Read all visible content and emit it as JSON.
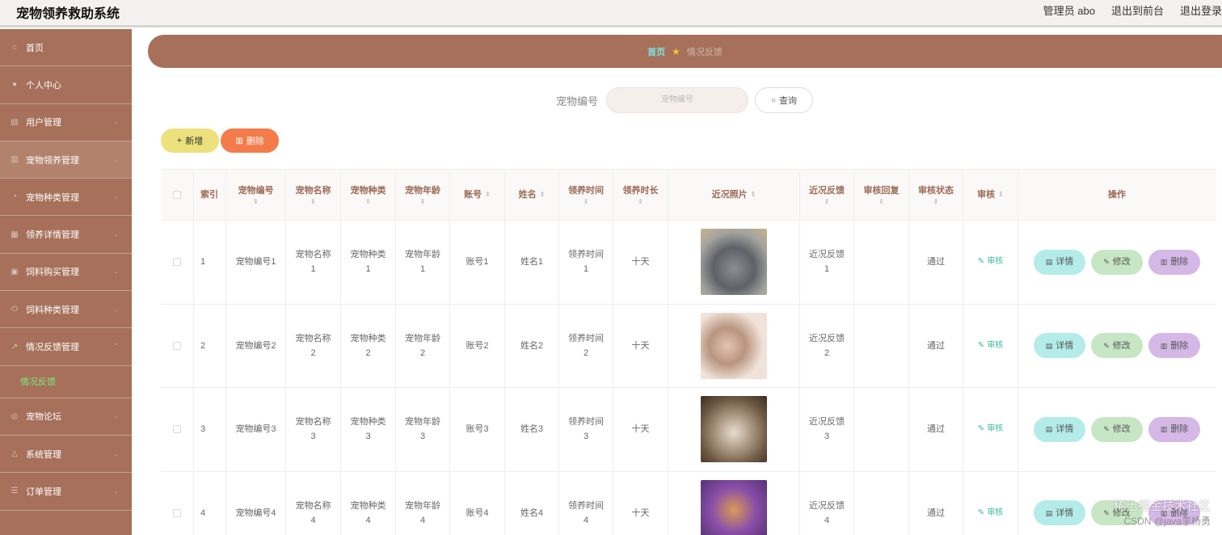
{
  "header": {
    "title": "宠物领养救助系统",
    "admin_label": "管理员 abo",
    "back_to_front": "退出到前台",
    "logout": "退出登录"
  },
  "sidebar": {
    "items": [
      {
        "label": "首页",
        "icon": "home-icon"
      },
      {
        "label": "个人中心",
        "icon": "user-icon"
      },
      {
        "label": "用户管理",
        "icon": "document-icon"
      },
      {
        "label": "宠物领养管理",
        "icon": "chart-icon"
      },
      {
        "label": "宠物种类管理",
        "icon": "dashboard-icon"
      },
      {
        "label": "领养详情管理",
        "icon": "grid-icon"
      },
      {
        "label": "饲料购买管理",
        "icon": "briefcase-icon"
      },
      {
        "label": "饲料种类管理",
        "icon": "power-icon"
      },
      {
        "label": "情况反馈管理",
        "icon": "trend-icon"
      },
      {
        "label": "宠物论坛",
        "icon": "compass-icon"
      },
      {
        "label": "系统管理",
        "icon": "bell-icon"
      },
      {
        "label": "订单管理",
        "icon": "sliders-icon"
      }
    ],
    "submenu_label": "情况反馈"
  },
  "breadcrumb": {
    "home": "首页",
    "current": "情况反馈"
  },
  "search": {
    "label": "宠物编号",
    "placeholder": "宠物编号",
    "button": "查询"
  },
  "toolbar": {
    "add_label": "新增",
    "delete_label": "删除"
  },
  "table": {
    "headers": {
      "index": "索引",
      "pet_no": "宠物编号",
      "pet_name": "宠物名称",
      "pet_type": "宠物种类",
      "pet_age": "宠物年龄",
      "account": "账号",
      "name": "姓名",
      "adopt_time": "领养时间",
      "adopt_duration": "领养时长",
      "photo": "近况照片",
      "feedback": "近况反馈",
      "reply": "审核回复",
      "status": "审核状态",
      "audit": "审核",
      "actions": "操作"
    },
    "rows": [
      {
        "index": "1",
        "pet_no": "宠物编号1",
        "pet_name": "宠物名称1",
        "pet_type": "宠物种类1",
        "pet_age": "宠物年龄1",
        "account": "账号1",
        "name": "姓名1",
        "adopt_time": "领养时间1",
        "duration": "十天",
        "feedback": "近况反馈1",
        "reply": "",
        "status": "通过",
        "audit": "审核"
      },
      {
        "index": "2",
        "pet_no": "宠物编号2",
        "pet_name": "宠物名称2",
        "pet_type": "宠物种类2",
        "pet_age": "宠物年龄2",
        "account": "账号2",
        "name": "姓名2",
        "adopt_time": "领养时间2",
        "duration": "十天",
        "feedback": "近况反馈2",
        "reply": "",
        "status": "通过",
        "audit": "审核"
      },
      {
        "index": "3",
        "pet_no": "宠物编号3",
        "pet_name": "宠物名称3",
        "pet_type": "宠物种类3",
        "pet_age": "宠物年龄3",
        "account": "账号3",
        "name": "姓名3",
        "adopt_time": "领养时间3",
        "duration": "十天",
        "feedback": "近况反馈3",
        "reply": "",
        "status": "通过",
        "audit": "审核"
      },
      {
        "index": "4",
        "pet_no": "宠物编号4",
        "pet_name": "宠物名称4",
        "pet_type": "宠物种类4",
        "pet_age": "宠物年龄4",
        "account": "账号4",
        "name": "姓名4",
        "adopt_time": "领养时间4",
        "duration": "十天",
        "feedback": "近况反馈4",
        "reply": "",
        "status": "通过",
        "audit": "审核"
      }
    ],
    "action_labels": {
      "detail": "详情",
      "edit": "修改",
      "delete": "删除"
    }
  },
  "watermark": {
    "line1": "稀土掘金技术社区",
    "line2": "CSDN @java李杨勇"
  }
}
